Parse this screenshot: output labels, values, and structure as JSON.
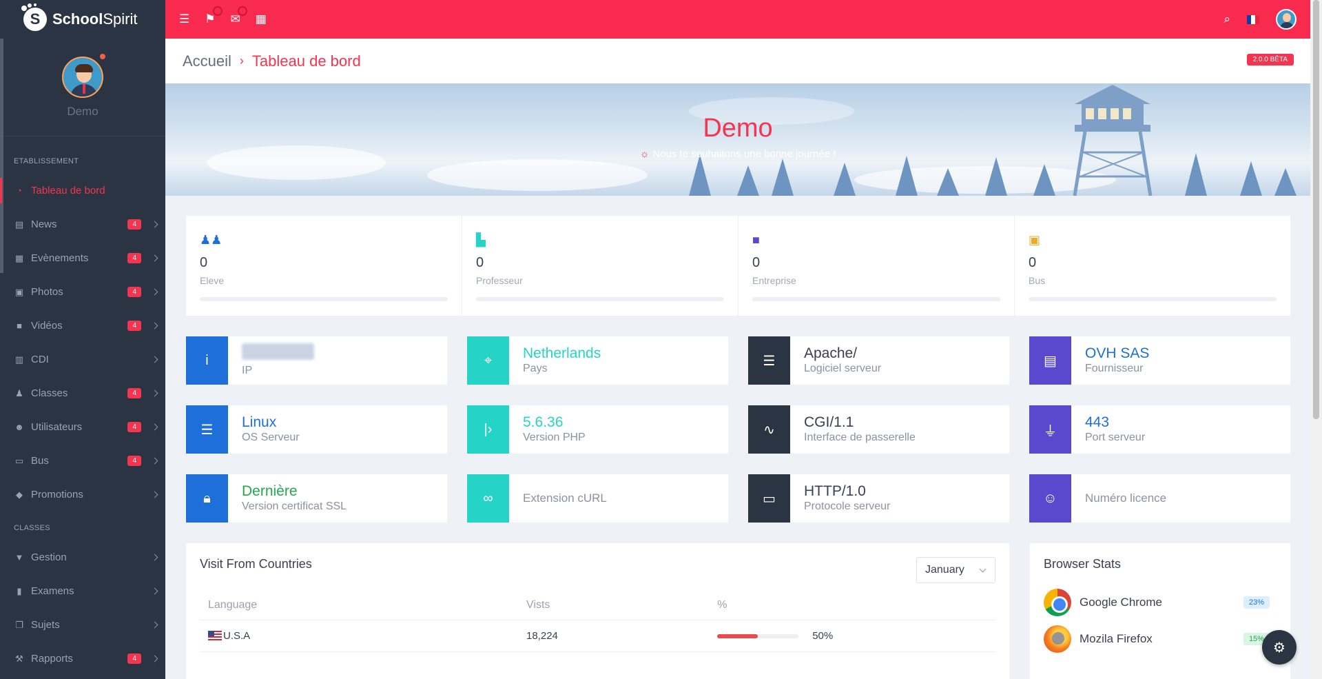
{
  "brand": {
    "name_bold": "School",
    "name_regular": "Spirit",
    "logo_letter": "S"
  },
  "profile": {
    "name": "Demo"
  },
  "sidebar": {
    "section_etab": "ETABLISSEMENT",
    "section_classes": "CLASSES",
    "items": [
      {
        "label": "Tableau de bord",
        "icon": "dashboard-icon",
        "badge": null,
        "active": true
      },
      {
        "label": "News",
        "icon": "news-icon",
        "badge": "4"
      },
      {
        "label": "Evènements",
        "icon": "events-icon",
        "badge": "4"
      },
      {
        "label": "Photos",
        "icon": "photos-icon",
        "badge": "4"
      },
      {
        "label": "Vidéos",
        "icon": "video-icon",
        "badge": "4"
      },
      {
        "label": "CDI",
        "icon": "book-icon",
        "badge": null
      },
      {
        "label": "Classes",
        "icon": "people-icon",
        "badge": "4"
      },
      {
        "label": "Utilisateurs",
        "icon": "user-icon",
        "badge": "4"
      },
      {
        "label": "Bus",
        "icon": "bus-icon",
        "badge": "4"
      },
      {
        "label": "Promotions",
        "icon": "graduation-icon",
        "badge": null
      }
    ],
    "classes_items": [
      {
        "label": "Gestion",
        "icon": "tie-icon",
        "badge": null
      },
      {
        "label": "Examens",
        "icon": "exam-icon",
        "badge": null
      },
      {
        "label": "Sujets",
        "icon": "copy-icon",
        "badge": null
      },
      {
        "label": "Rapports",
        "icon": "gavel-icon",
        "badge": "4"
      }
    ]
  },
  "breadcrumb": {
    "home": "Accueil",
    "current": "Tableau de bord",
    "version": "2.0.0 BÊTA"
  },
  "banner": {
    "title": "Demo",
    "subtitle": "Nous te souhaitons une bonne journée !"
  },
  "stats": [
    {
      "value": "0",
      "label": "Eleve",
      "icon": "students-icon",
      "color": "#1e6fd9"
    },
    {
      "value": "0",
      "label": "Professeur",
      "icon": "teacher-icon",
      "color": "#26d4c7"
    },
    {
      "value": "0",
      "label": "Entreprise",
      "icon": "briefcase-icon",
      "color": "#5a48cf"
    },
    {
      "value": "0",
      "label": "Bus",
      "icon": "bus-icon",
      "color": "#f5a623"
    }
  ],
  "info": {
    "ip": {
      "value": "",
      "label": "IP"
    },
    "country": {
      "value": "Netherlands",
      "label": "Pays"
    },
    "server_software": {
      "value": "Apache/",
      "label": "Logiciel serveur"
    },
    "provider": {
      "value": "OVH SAS",
      "label": "Fournisseur"
    },
    "os": {
      "value": "Linux",
      "label": "OS Serveur"
    },
    "php": {
      "value": "5.6.36",
      "label": "Version PHP"
    },
    "gateway": {
      "value": "CGI/1.1",
      "label": "Interface de passerelle"
    },
    "port": {
      "value": "443",
      "label": "Port serveur"
    },
    "ssl": {
      "value": "Dernière",
      "label": "Version certificat SSL"
    },
    "curl": {
      "label": "Extension cURL"
    },
    "protocol": {
      "value": "HTTP/1.0",
      "label": "Protocole serveur"
    },
    "license": {
      "label": "Numéro licence"
    }
  },
  "visits": {
    "title": "Visit From Countries",
    "month": "January",
    "columns": [
      "Language",
      "Vists",
      "%"
    ],
    "rows": [
      {
        "country": "U.S.A",
        "visits": "18,224",
        "percent": "50%",
        "fraction": 0.5
      }
    ]
  },
  "browsers": {
    "title": "Browser Stats",
    "items": [
      {
        "name": "Google Chrome",
        "percent": "23%"
      },
      {
        "name": "Mozila Firefox",
        "percent": "15%"
      }
    ]
  }
}
